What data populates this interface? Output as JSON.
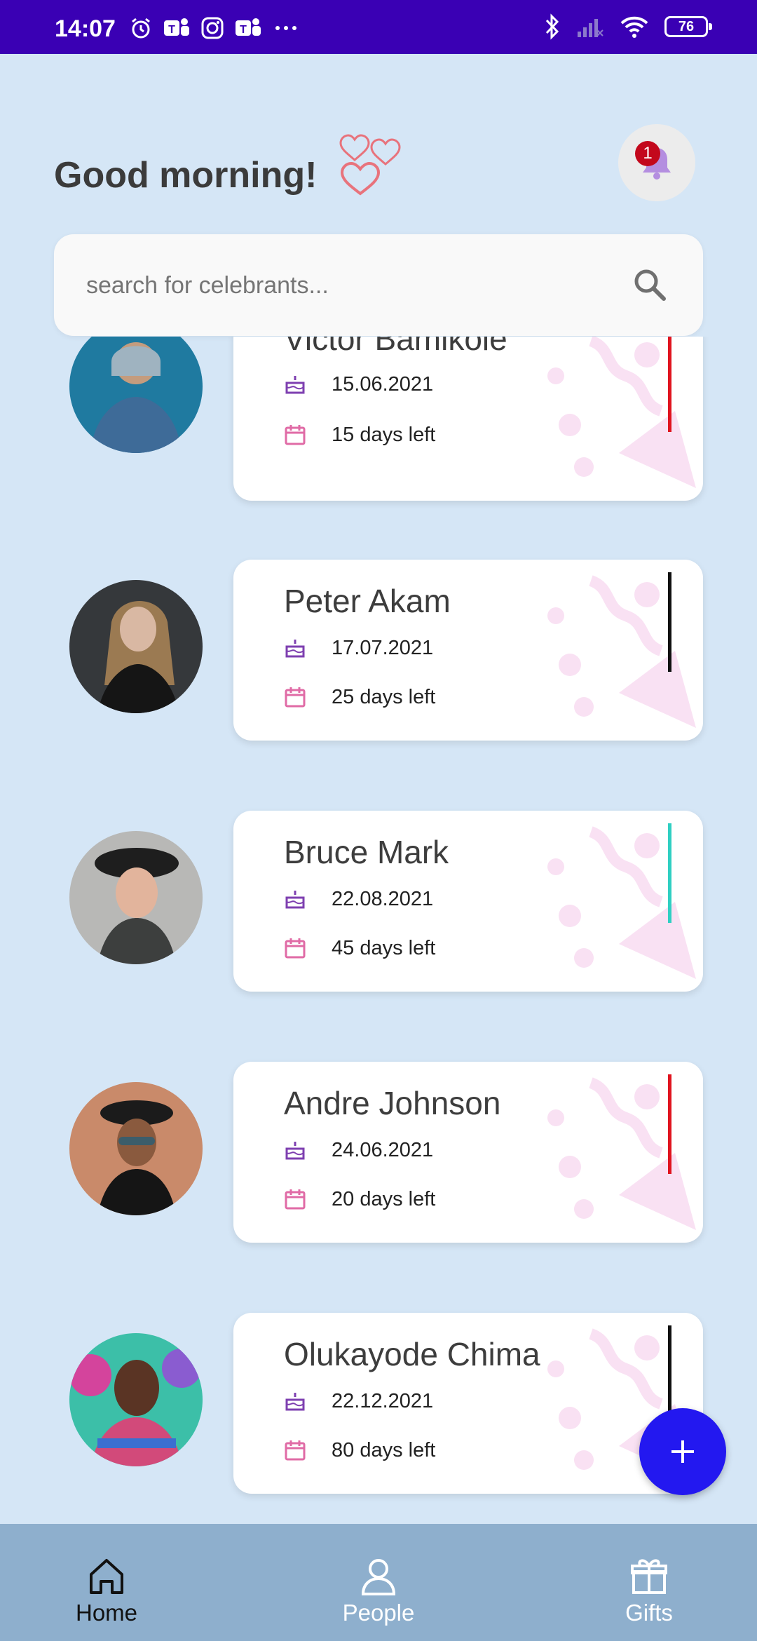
{
  "status_bar": {
    "time": "14:07",
    "battery": "76",
    "icons": [
      "alarm-icon",
      "teams-icon",
      "instagram-icon",
      "teams-icon",
      "more-icon",
      "bluetooth-icon",
      "signal-icon",
      "wifi-icon",
      "battery-icon"
    ]
  },
  "header": {
    "greeting": "Good morning!",
    "notification_count": "1"
  },
  "search": {
    "placeholder": "search for celebrants..."
  },
  "celebrants": [
    {
      "name": "Victor Bamikole",
      "date": "15.06.2021",
      "days_left": "15 days left",
      "accent": "#e0141f"
    },
    {
      "name": "Peter Akam",
      "date": "17.07.2021",
      "days_left": "25 days left",
      "accent": "#111111"
    },
    {
      "name": "Bruce Mark",
      "date": "22.08.2021",
      "days_left": "45 days left",
      "accent": "#2fcfc2"
    },
    {
      "name": "Andre Johnson",
      "date": "24.06.2021",
      "days_left": "20 days left",
      "accent": "#e0141f"
    },
    {
      "name": "Olukayode Chima",
      "date": "22.12.2021",
      "days_left": "80 days left",
      "accent": "#111111"
    }
  ],
  "bottom_nav": {
    "home": "Home",
    "people": "People",
    "gifts": "Gifts"
  },
  "colors": {
    "status_bar": "#3a00b4",
    "background": "#d5e6f6",
    "fab": "#2318f0",
    "nav": "#8eafcd",
    "badge": "#c3081c"
  }
}
